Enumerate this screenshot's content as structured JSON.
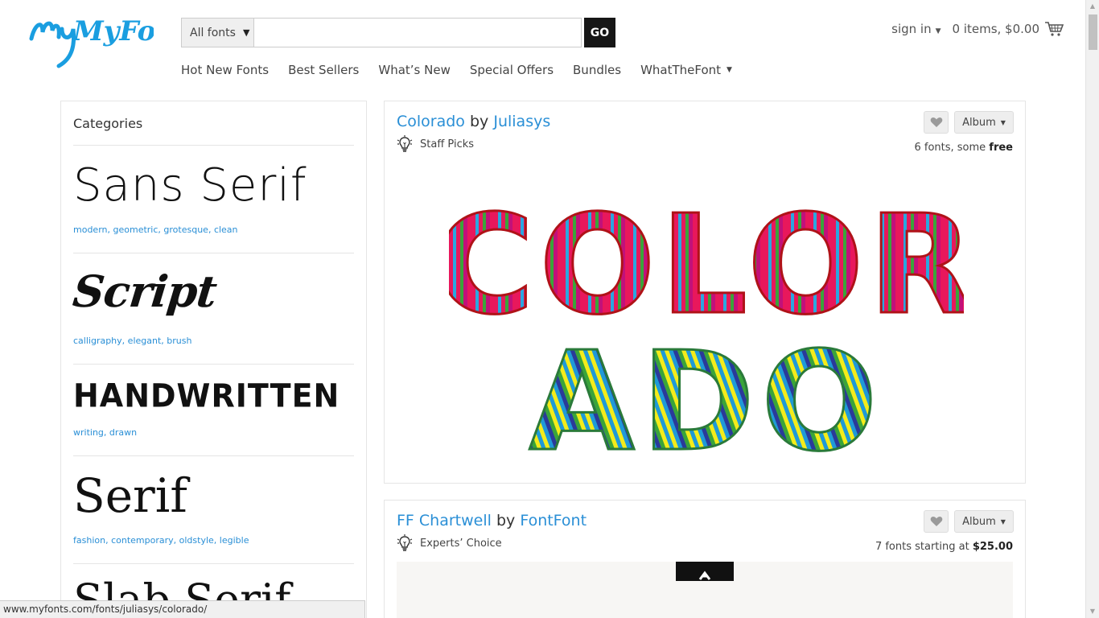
{
  "header": {
    "logo_text": "MyFonts",
    "search": {
      "scope": "All fonts",
      "value": "",
      "placeholder": "",
      "go_label": "GO"
    },
    "nav": [
      {
        "label": "Hot New Fonts"
      },
      {
        "label": "Best Sellers"
      },
      {
        "label": "What’s New"
      },
      {
        "label": "Special Offers"
      },
      {
        "label": "Bundles"
      },
      {
        "label": "WhatTheFont"
      }
    ],
    "sign_in": "sign in",
    "cart": "0 items, $0.00"
  },
  "sidebar": {
    "title": "Categories",
    "categories": [
      {
        "sample": "Sans Serif",
        "tags": [
          "modern",
          "geometric",
          "grotesque",
          "clean"
        ]
      },
      {
        "sample": "Script",
        "tags": [
          "calligraphy",
          "elegant",
          "brush"
        ]
      },
      {
        "sample": "HANDWRITTEN",
        "tags": [
          "writing",
          "drawn"
        ]
      },
      {
        "sample": "Serif",
        "tags": [
          "fashion",
          "contemporary",
          "oldstyle",
          "legible"
        ]
      },
      {
        "sample": "Slab Serif",
        "tags": []
      }
    ]
  },
  "cards": [
    {
      "name": "Colorado",
      "by": "by",
      "foundry": "Juliasys",
      "award": "Staff Picks",
      "album": "Album",
      "count_text": "6 fonts, some ",
      "count_strong": "free",
      "preview_text": [
        "COLOR",
        "ADO"
      ]
    },
    {
      "name": "FF Chartwell",
      "by": "by",
      "foundry": "FontFont",
      "award": "Experts’ Choice",
      "album": "Album",
      "count_text": "7 fonts starting at ",
      "count_strong": "$25.00"
    }
  ],
  "colors": {
    "brand_blue": "#1a9ee0",
    "link_blue": "#2a8fd6",
    "go_button": "#161616"
  },
  "status_bar": "www.myfonts.com/fonts/juliasys/colorado/"
}
